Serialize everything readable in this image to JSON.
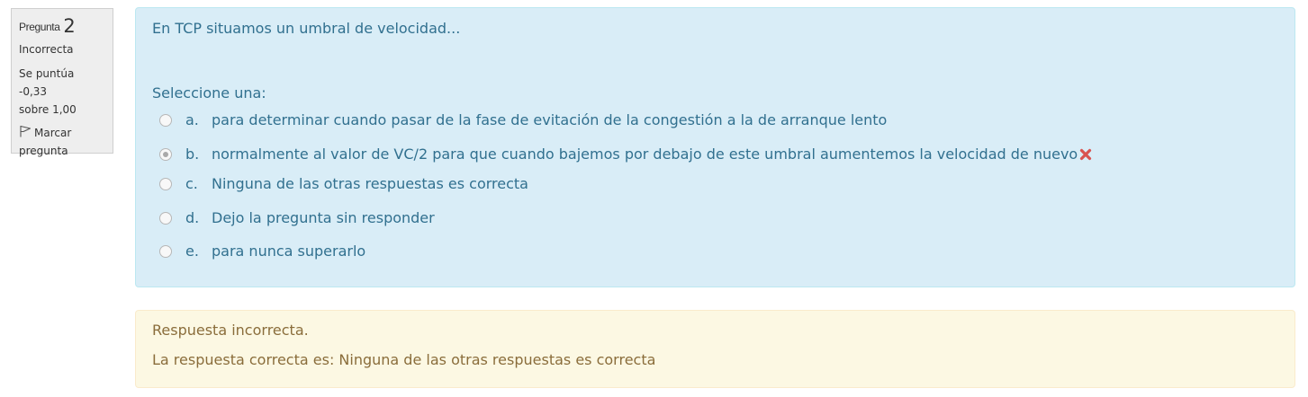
{
  "question_info": {
    "question_word": "Pregunta",
    "question_number": "2",
    "state": "Incorrecta",
    "grade_line1": "Se puntúa -0,33",
    "grade_line2": "sobre 1,00",
    "flag_line1": "Marcar",
    "flag_line2": "pregunta",
    "flag_icon": "flag-outline-icon"
  },
  "question": {
    "text": "En TCP situamos un umbral de velocidad...",
    "prompt": "Seleccione una:",
    "answers": [
      {
        "letter": "a.",
        "text": "para determinar cuando pasar de la fase de evitación de la congestión a la de arranque lento",
        "selected": false
      },
      {
        "letter": "b.",
        "text": "normalmente al valor de VC/2 para que cuando bajemos por debajo de este umbral aumentemos la velocidad de nuevo",
        "selected": true,
        "marked_incorrect": true
      },
      {
        "letter": "c.",
        "text": "Ninguna de las otras respuestas es correcta",
        "selected": false
      },
      {
        "letter": "d.",
        "text": "Dejo la pregunta sin responder",
        "selected": false
      },
      {
        "letter": "e.",
        "text": "para nunca superarlo",
        "selected": false
      }
    ]
  },
  "feedback": {
    "result": "Respuesta incorrecta.",
    "right_answer": "La respuesta correcta es: Ninguna de las otras respuestas es correcta"
  },
  "colors": {
    "formulation_bg": "#d9edf7",
    "formulation_text": "#31708f",
    "feedback_bg": "#fcf8e3",
    "feedback_text": "#8a6d3b",
    "incorrect_mark": "#d9534f"
  }
}
